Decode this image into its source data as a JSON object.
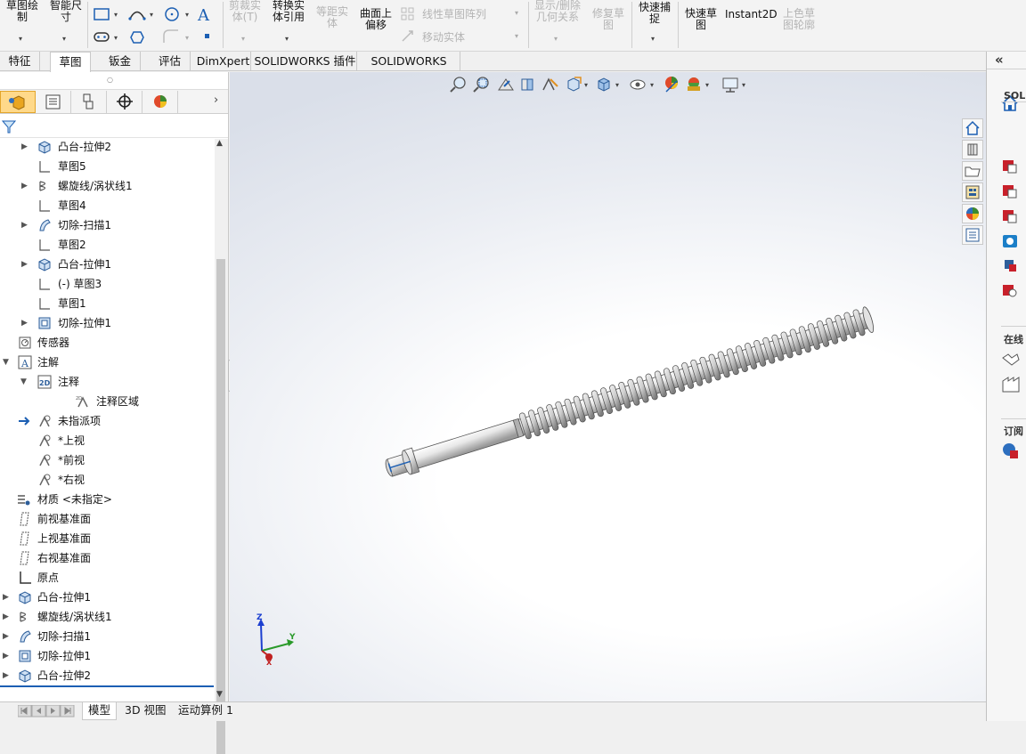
{
  "ribbon": {
    "sketch_draw_l1": "草图绘",
    "sketch_draw_l2": "制",
    "smart_dim_l1": "智能尺",
    "smart_dim_l2": "寸",
    "trim_l1": "剪裁实",
    "trim_l2": "体(T)",
    "convert_l1": "转换实",
    "convert_l2": "体引用",
    "offset_dist_l1": "等距实",
    "offset_dist_l2": "体",
    "surface_offset_l1": "曲面上",
    "surface_offset_l2": "偏移",
    "linear_pattern": "线性草图阵列",
    "move_entities": "移动实体",
    "show_delete_l1": "显示/删除",
    "show_delete_l2": "几何关系",
    "repair_l1": "修复草",
    "repair_l2": "图",
    "quick_snap_l1": "快速捕",
    "quick_snap_l2": "捉",
    "rapid_sketch_l1": "快速草",
    "rapid_sketch_l2": "图",
    "instant2d": "Instant2D",
    "shaded_l1": "上色草",
    "shaded_l2": "图轮廓"
  },
  "tabs": [
    {
      "label": "特征"
    },
    {
      "label": "草图"
    },
    {
      "label": "钣金"
    },
    {
      "label": "评估"
    },
    {
      "label": "DimXpert"
    },
    {
      "label": "SOLIDWORKS 插件"
    },
    {
      "label": "SOLIDWORKS MBD"
    }
  ],
  "tree": [
    {
      "label": "凸台-拉伸2",
      "icon": "extrude-boss-icon"
    },
    {
      "label": "草图5",
      "icon": "sketch-icon"
    },
    {
      "label": "螺旋线/涡状线1",
      "icon": "helix-icon"
    },
    {
      "label": "草图4",
      "icon": "sketch-icon"
    },
    {
      "label": "切除-扫描1",
      "icon": "sweep-cut-icon"
    },
    {
      "label": "草图2",
      "icon": "sketch-icon"
    },
    {
      "label": "凸台-拉伸1",
      "icon": "extrude-boss-icon"
    },
    {
      "label": "(-) 草图3",
      "icon": "sketch-icon"
    },
    {
      "label": "草图1",
      "icon": "sketch-icon"
    },
    {
      "label": "切除-拉伸1",
      "icon": "extrude-cut-icon"
    },
    {
      "label": "传感器",
      "icon": "sensor-icon"
    },
    {
      "label": "注解",
      "icon": "annotation-icon"
    },
    {
      "label": "注释",
      "icon": "notes-2d-icon"
    },
    {
      "label": "注释区域",
      "icon": "note-area-icon"
    },
    {
      "label": "未指派项",
      "icon": "unassigned-icon"
    },
    {
      "label": "*上视",
      "icon": "view-icon"
    },
    {
      "label": "*前视",
      "icon": "view-icon"
    },
    {
      "label": "*右视",
      "icon": "view-icon"
    },
    {
      "label": "材质 <未指定>",
      "icon": "material-icon"
    },
    {
      "label": "前视基准面",
      "icon": "plane-icon"
    },
    {
      "label": "上视基准面",
      "icon": "plane-icon"
    },
    {
      "label": "右视基准面",
      "icon": "plane-icon"
    },
    {
      "label": "原点",
      "icon": "origin-icon"
    },
    {
      "label": "凸台-拉伸1",
      "icon": "extrude-boss-icon"
    },
    {
      "label": "螺旋线/涡状线1",
      "icon": "helix-icon"
    },
    {
      "label": "切除-扫描1",
      "icon": "sweep-cut-icon"
    },
    {
      "label": "切除-拉伸1",
      "icon": "extrude-cut-icon"
    },
    {
      "label": "凸台-拉伸2",
      "icon": "extrude-boss-icon"
    }
  ],
  "bottom_tabs": [
    {
      "label": "模型"
    },
    {
      "label": "3D 视图"
    },
    {
      "label": "运动算例 1"
    }
  ],
  "triad": {
    "x": "X",
    "y": "Y",
    "z": "Z"
  },
  "right_pane": {
    "collapse": "«",
    "section1": "SOLI",
    "section2": "在线",
    "section3": "订阅"
  },
  "colors": {
    "accent": "#e3a52b",
    "selected_tab": "#ffd98a",
    "model": "#d4d4d4"
  }
}
